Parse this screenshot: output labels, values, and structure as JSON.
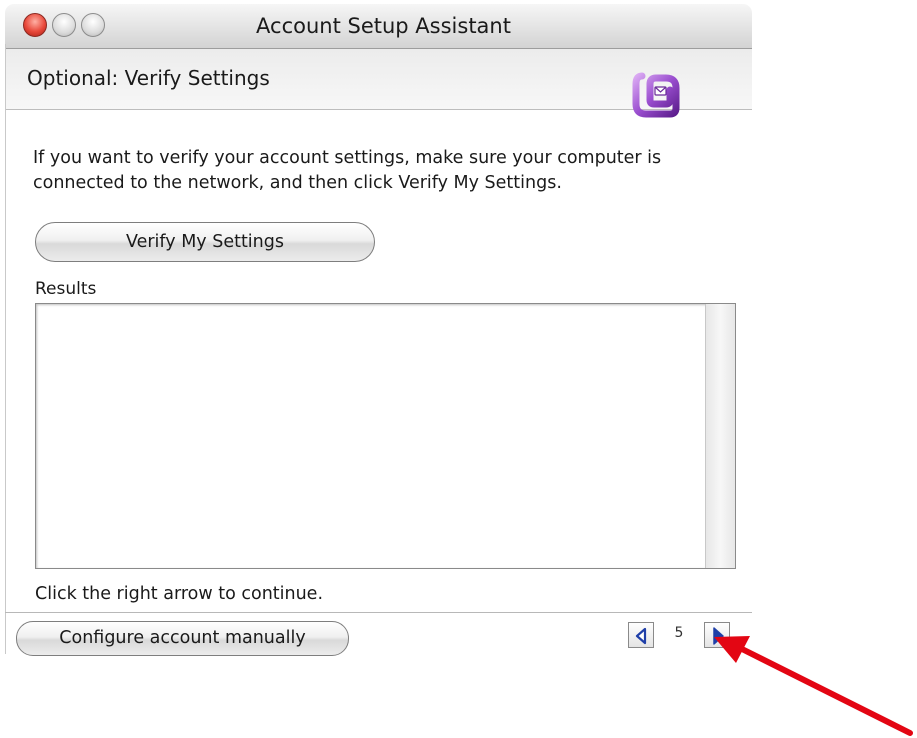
{
  "window": {
    "title": "Account Setup Assistant"
  },
  "header": {
    "title": "Optional: Verify Settings",
    "icon": "entourage-app-icon"
  },
  "content": {
    "instructions": "If you want to verify your account settings, make sure your computer is connected to the network, and then click Verify My Settings.",
    "verify_button_label": "Verify My Settings",
    "results_label": "Results",
    "results_value": "",
    "continue_text": "Click the right arrow to continue."
  },
  "footer": {
    "configure_button_label": "Configure account manually",
    "page_number": "5",
    "prev_icon": "left-arrow-icon",
    "next_icon": "right-arrow-icon"
  },
  "colors": {
    "close_button": "#e8483a",
    "annotation_arrow": "#e30613",
    "nav_arrow": "#1f3fa8",
    "icon_purple": "#8a3fbf"
  }
}
